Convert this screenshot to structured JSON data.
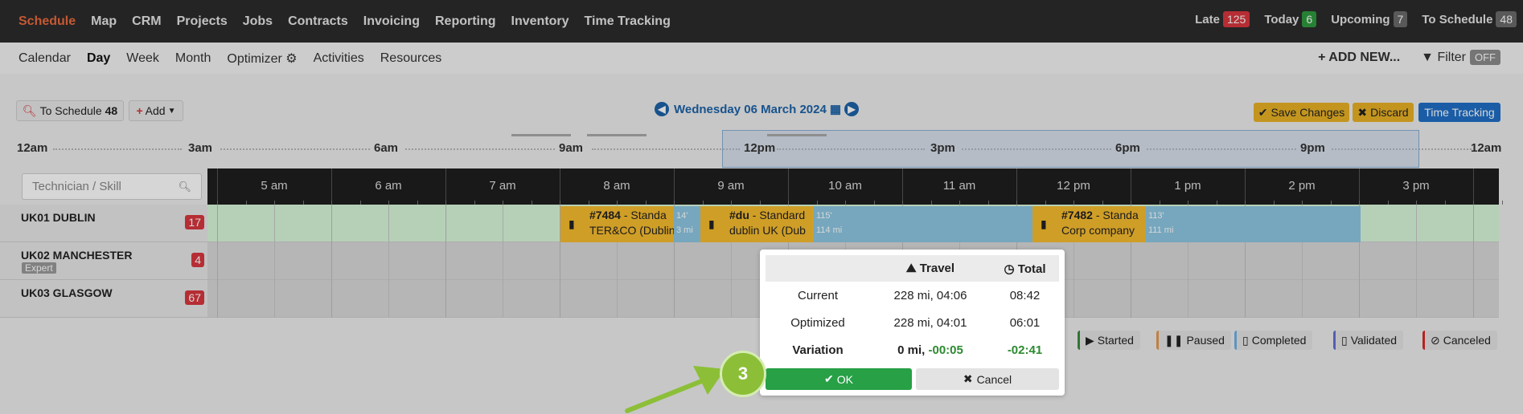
{
  "nav": {
    "items": [
      "Schedule",
      "Map",
      "CRM",
      "Projects",
      "Jobs",
      "Contracts",
      "Invoicing",
      "Reporting",
      "Inventory",
      "Time Tracking"
    ],
    "active": "Schedule",
    "counters": [
      {
        "label": "Late",
        "count": "125",
        "color": "#d9363e"
      },
      {
        "label": "Today",
        "count": "6",
        "color": "#2f9a3e"
      },
      {
        "label": "Upcoming",
        "count": "7",
        "color": "#6b6b6b"
      },
      {
        "label": "To Schedule",
        "count": "48",
        "color": "#6b6b6b"
      }
    ]
  },
  "subnav": {
    "items": [
      "Calendar",
      "Day",
      "Week",
      "Month",
      "Optimizer",
      "Activities",
      "Resources"
    ],
    "active": "Day",
    "add_new": "ADD NEW...",
    "filter_label": "Filter",
    "filter_state": "OFF"
  },
  "toolbar": {
    "to_schedule_label": "To Schedule",
    "to_schedule_count": "48",
    "add_label": "Add",
    "date": "Wednesday 06 March 2024",
    "save_label": "Save Changes",
    "discard_label": "Discard",
    "time_tracking_label": "Time Tracking"
  },
  "overview_labels": [
    "12am",
    "3am",
    "6am",
    "9am",
    "12pm",
    "3pm",
    "6pm",
    "9pm",
    "12am"
  ],
  "scheduler": {
    "search_placeholder": "Technician / Skill",
    "hours": [
      "5 am",
      "6 am",
      "7 am",
      "8 am",
      "9 am",
      "10 am",
      "11 am",
      "12 pm",
      "1 pm",
      "2 pm",
      "3 pm"
    ],
    "resources": [
      {
        "name": "UK01 DUBLIN",
        "count": "17",
        "skill": ""
      },
      {
        "name": "UK02 MANCHESTER",
        "count": "4",
        "skill": "Expert"
      },
      {
        "name": "UK03 GLASGOW",
        "count": "67",
        "skill": ""
      }
    ],
    "jobs": [
      {
        "id": "#7484",
        "type": " - Standa",
        "client": "TER&CO (Dublin"
      },
      {
        "id": "#du",
        "type": " - Standard",
        "client": "dublin UK (Dub"
      },
      {
        "id": "#7482",
        "type": " - Standa",
        "client": "Corp company"
      }
    ],
    "travels": [
      {
        "minutes": "14'",
        "distance": "3 mi"
      },
      {
        "minutes": "115'",
        "distance": "114 mi"
      },
      {
        "minutes": "113'",
        "distance": "111 mi"
      }
    ]
  },
  "legend": [
    "Started",
    "Paused",
    "Completed",
    "Validated",
    "Canceled"
  ],
  "popup": {
    "headers": {
      "travel": "Travel",
      "total": "Total"
    },
    "rows": [
      {
        "label": "Current",
        "travel": "228 mi, 04:06",
        "total": "08:42"
      },
      {
        "label": "Optimized",
        "travel": "228 mi, 04:01",
        "total": "06:01"
      }
    ],
    "variation": {
      "label": "Variation",
      "distance": "0 mi",
      "time": "-00:05",
      "total": "-02:41"
    },
    "ok_label": "OK",
    "cancel_label": "Cancel"
  },
  "step_number": "3",
  "colors": {
    "accent": "#ea6a3f",
    "job": "#f7bd2f",
    "travel": "#8dc7e3",
    "ok": "#27a046",
    "step": "#8cbf37"
  }
}
